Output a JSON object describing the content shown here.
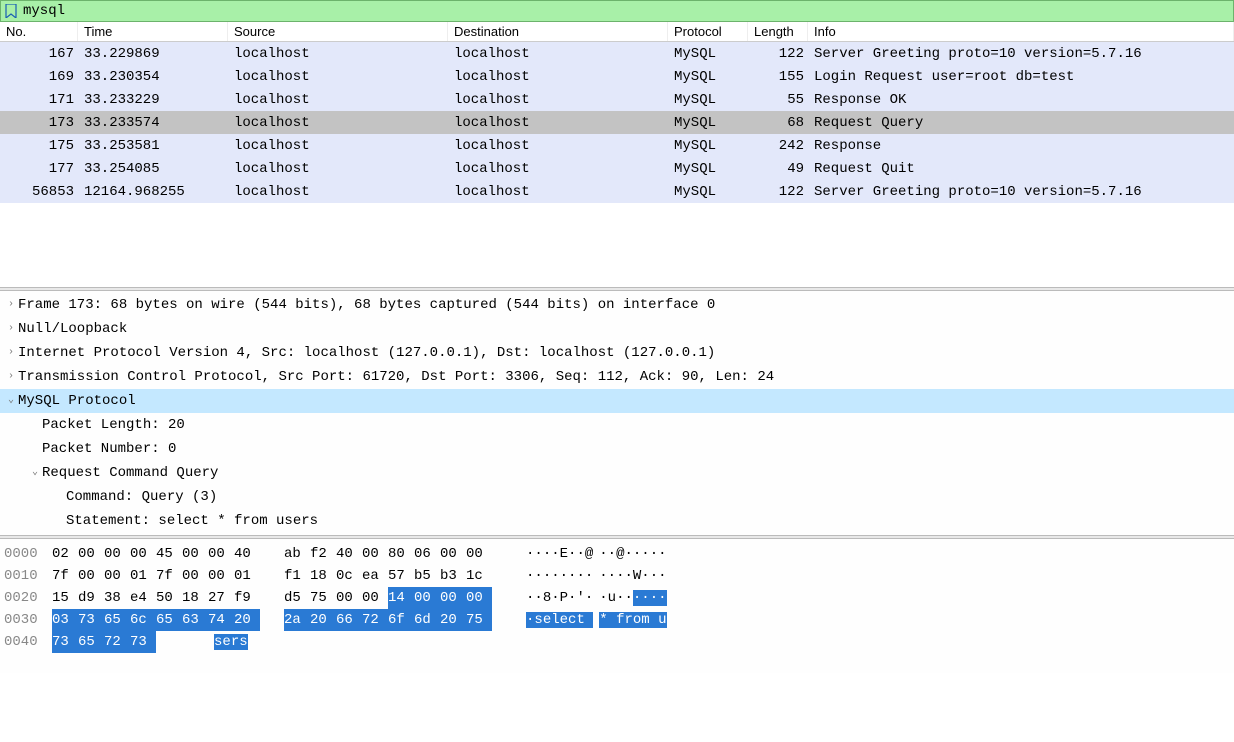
{
  "filter": {
    "value": "mysql"
  },
  "columns": {
    "no": "No.",
    "time": "Time",
    "src": "Source",
    "dst": "Destination",
    "proto": "Protocol",
    "len": "Length",
    "info": "Info"
  },
  "packets": [
    {
      "no": "167",
      "time": "33.229869",
      "src": "localhost",
      "dst": "localhost",
      "proto": "MySQL",
      "len": "122",
      "info": "Server Greeting proto=10 version=5.7.16",
      "selected": false
    },
    {
      "no": "169",
      "time": "33.230354",
      "src": "localhost",
      "dst": "localhost",
      "proto": "MySQL",
      "len": "155",
      "info": "Login Request user=root db=test",
      "selected": false
    },
    {
      "no": "171",
      "time": "33.233229",
      "src": "localhost",
      "dst": "localhost",
      "proto": "MySQL",
      "len": "55",
      "info": "Response OK",
      "selected": false
    },
    {
      "no": "173",
      "time": "33.233574",
      "src": "localhost",
      "dst": "localhost",
      "proto": "MySQL",
      "len": "68",
      "info": "Request Query",
      "selected": true
    },
    {
      "no": "175",
      "time": "33.253581",
      "src": "localhost",
      "dst": "localhost",
      "proto": "MySQL",
      "len": "242",
      "info": "Response",
      "selected": false
    },
    {
      "no": "177",
      "time": "33.254085",
      "src": "localhost",
      "dst": "localhost",
      "proto": "MySQL",
      "len": "49",
      "info": "Request Quit",
      "selected": false
    },
    {
      "no": "56853",
      "time": "12164.968255",
      "src": "localhost",
      "dst": "localhost",
      "proto": "MySQL",
      "len": "122",
      "info": "Server Greeting proto=10 version=5.7.16",
      "selected": false
    }
  ],
  "details": [
    {
      "toggle": ">",
      "indent": 0,
      "text": "Frame 173: 68 bytes on wire (544 bits), 68 bytes captured (544 bits) on interface 0",
      "highlight": false
    },
    {
      "toggle": ">",
      "indent": 0,
      "text": "Null/Loopback",
      "highlight": false
    },
    {
      "toggle": ">",
      "indent": 0,
      "text": "Internet Protocol Version 4, Src: localhost (127.0.0.1), Dst: localhost (127.0.0.1)",
      "highlight": false
    },
    {
      "toggle": ">",
      "indent": 0,
      "text": "Transmission Control Protocol, Src Port: 61720, Dst Port: 3306, Seq: 112, Ack: 90, Len: 24",
      "highlight": false
    },
    {
      "toggle": "v",
      "indent": 0,
      "text": "MySQL Protocol",
      "highlight": true
    },
    {
      "toggle": "",
      "indent": 1,
      "text": "Packet Length: 20",
      "highlight": false
    },
    {
      "toggle": "",
      "indent": 1,
      "text": "Packet Number: 0",
      "highlight": false
    },
    {
      "toggle": "v",
      "indent": 1,
      "text": "Request Command Query",
      "highlight": false
    },
    {
      "toggle": "",
      "indent": 2,
      "text": "Command: Query (3)",
      "highlight": false
    },
    {
      "toggle": "",
      "indent": 2,
      "text": "Statement: select * from users",
      "highlight": false
    }
  ],
  "hex": [
    {
      "offset": "0000",
      "g1": [
        {
          "b": "02"
        },
        {
          "b": "00"
        },
        {
          "b": "00"
        },
        {
          "b": "00"
        },
        {
          "b": "45"
        },
        {
          "b": "00"
        },
        {
          "b": "00"
        },
        {
          "b": "40"
        }
      ],
      "g2": [
        {
          "b": "ab"
        },
        {
          "b": "f2"
        },
        {
          "b": "40"
        },
        {
          "b": "00"
        },
        {
          "b": "80"
        },
        {
          "b": "06"
        },
        {
          "b": "00"
        },
        {
          "b": "00"
        }
      ],
      "a1": [
        {
          "c": "·"
        },
        {
          "c": "·"
        },
        {
          "c": "·"
        },
        {
          "c": "·"
        },
        {
          "c": "E"
        },
        {
          "c": "·"
        },
        {
          "c": "·"
        },
        {
          "c": "@"
        }
      ],
      "a2": [
        {
          "c": "·"
        },
        {
          "c": "·"
        },
        {
          "c": "@"
        },
        {
          "c": "·"
        },
        {
          "c": "·"
        },
        {
          "c": "·"
        },
        {
          "c": "·"
        },
        {
          "c": "·"
        }
      ]
    },
    {
      "offset": "0010",
      "g1": [
        {
          "b": "7f"
        },
        {
          "b": "00"
        },
        {
          "b": "00"
        },
        {
          "b": "01"
        },
        {
          "b": "7f"
        },
        {
          "b": "00"
        },
        {
          "b": "00"
        },
        {
          "b": "01"
        }
      ],
      "g2": [
        {
          "b": "f1"
        },
        {
          "b": "18"
        },
        {
          "b": "0c"
        },
        {
          "b": "ea"
        },
        {
          "b": "57"
        },
        {
          "b": "b5"
        },
        {
          "b": "b3"
        },
        {
          "b": "1c"
        }
      ],
      "a1": [
        {
          "c": "·"
        },
        {
          "c": "·"
        },
        {
          "c": "·"
        },
        {
          "c": "·"
        },
        {
          "c": "·"
        },
        {
          "c": "·"
        },
        {
          "c": "·"
        },
        {
          "c": "·"
        }
      ],
      "a2": [
        {
          "c": "·"
        },
        {
          "c": "·"
        },
        {
          "c": "·"
        },
        {
          "c": "·"
        },
        {
          "c": "W"
        },
        {
          "c": "·"
        },
        {
          "c": "·"
        },
        {
          "c": "·"
        }
      ]
    },
    {
      "offset": "0020",
      "g1": [
        {
          "b": "15"
        },
        {
          "b": "d9"
        },
        {
          "b": "38"
        },
        {
          "b": "e4"
        },
        {
          "b": "50"
        },
        {
          "b": "18"
        },
        {
          "b": "27"
        },
        {
          "b": "f9"
        }
      ],
      "g2": [
        {
          "b": "d5"
        },
        {
          "b": "75"
        },
        {
          "b": "00"
        },
        {
          "b": "00"
        },
        {
          "b": "14",
          "sel": true
        },
        {
          "b": "00",
          "sel": true
        },
        {
          "b": "00",
          "sel": true
        },
        {
          "b": "00",
          "sel": true
        }
      ],
      "a1": [
        {
          "c": "·"
        },
        {
          "c": "·"
        },
        {
          "c": "8"
        },
        {
          "c": "·"
        },
        {
          "c": "P"
        },
        {
          "c": "·"
        },
        {
          "c": "'"
        },
        {
          "c": "·"
        }
      ],
      "a2": [
        {
          "c": "·"
        },
        {
          "c": "u"
        },
        {
          "c": "·"
        },
        {
          "c": "·"
        },
        {
          "c": "·",
          "sel": true
        },
        {
          "c": "·",
          "sel": true
        },
        {
          "c": "·",
          "sel": true
        },
        {
          "c": "·",
          "sel": true
        }
      ]
    },
    {
      "offset": "0030",
      "g1": [
        {
          "b": "03",
          "sel": true
        },
        {
          "b": "73",
          "sel": true
        },
        {
          "b": "65",
          "sel": true
        },
        {
          "b": "6c",
          "sel": true
        },
        {
          "b": "65",
          "sel": true
        },
        {
          "b": "63",
          "sel": true
        },
        {
          "b": "74",
          "sel": true
        },
        {
          "b": "20",
          "sel": true
        }
      ],
      "g2": [
        {
          "b": "2a",
          "sel": true
        },
        {
          "b": "20",
          "sel": true
        },
        {
          "b": "66",
          "sel": true
        },
        {
          "b": "72",
          "sel": true
        },
        {
          "b": "6f",
          "sel": true
        },
        {
          "b": "6d",
          "sel": true
        },
        {
          "b": "20",
          "sel": true
        },
        {
          "b": "75",
          "sel": true
        }
      ],
      "a1": [
        {
          "c": "·",
          "sel": true
        },
        {
          "c": "s",
          "sel": true
        },
        {
          "c": "e",
          "sel": true
        },
        {
          "c": "l",
          "sel": true
        },
        {
          "c": "e",
          "sel": true
        },
        {
          "c": "c",
          "sel": true
        },
        {
          "c": "t",
          "sel": true
        },
        {
          "c": " ",
          "sel": true
        }
      ],
      "a2": [
        {
          "c": "*",
          "sel": true
        },
        {
          "c": " ",
          "sel": true
        },
        {
          "c": "f",
          "sel": true
        },
        {
          "c": "r",
          "sel": true
        },
        {
          "c": "o",
          "sel": true
        },
        {
          "c": "m",
          "sel": true
        },
        {
          "c": " ",
          "sel": true
        },
        {
          "c": "u",
          "sel": true
        }
      ]
    },
    {
      "offset": "0040",
      "g1": [
        {
          "b": "73",
          "sel": true
        },
        {
          "b": "65",
          "sel": true
        },
        {
          "b": "72",
          "sel": true
        },
        {
          "b": "73",
          "sel": true
        }
      ],
      "g2": [],
      "a1": [
        {
          "c": "s",
          "sel": true
        },
        {
          "c": "e",
          "sel": true
        },
        {
          "c": "r",
          "sel": true
        },
        {
          "c": "s",
          "sel": true
        }
      ],
      "a2": []
    }
  ]
}
